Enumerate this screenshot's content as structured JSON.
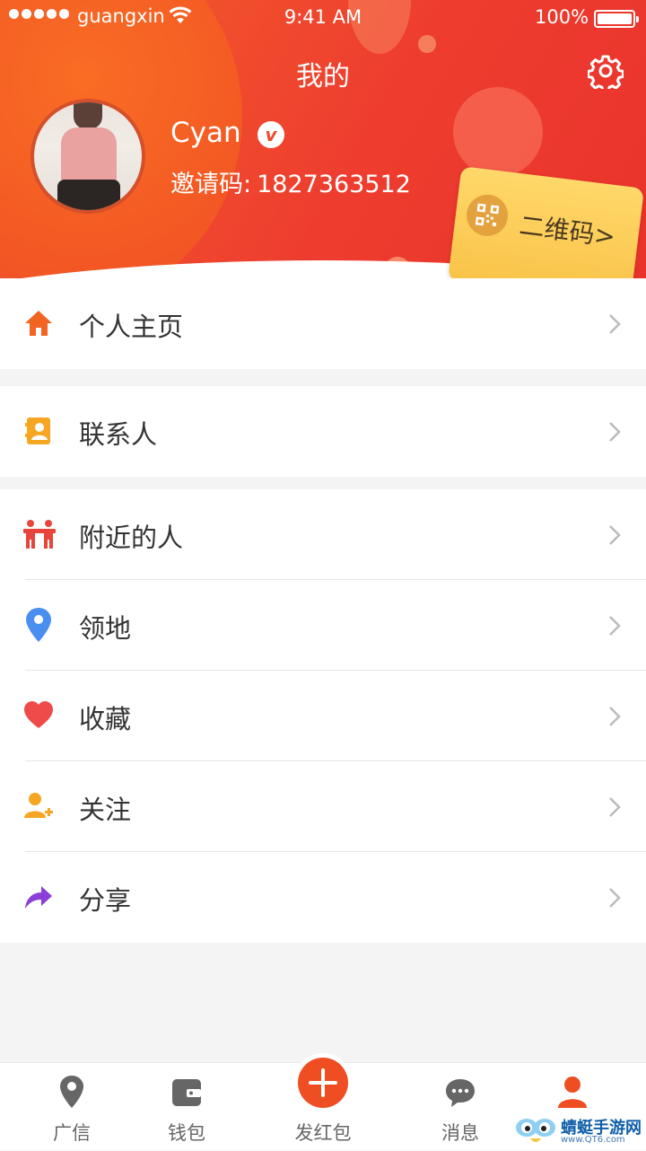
{
  "status_bar": {
    "carrier": "guangxin",
    "time": "9:41 AM",
    "battery": "100%"
  },
  "header": {
    "title": "我的"
  },
  "profile": {
    "name": "Cyan",
    "badge": "v",
    "invite_label": "邀请码:",
    "invite_code": "1827363512"
  },
  "qr_card": {
    "label": "二维码>"
  },
  "menu_groups": [
    [
      {
        "label": "个人主页",
        "icon": "home-icon",
        "color": "#f26422"
      }
    ],
    [
      {
        "label": "联系人",
        "icon": "contact-card-icon",
        "color": "#f5a623"
      }
    ],
    [
      {
        "label": "附近的人",
        "icon": "people-icon",
        "color": "#e8453c"
      },
      {
        "label": "领地",
        "icon": "location-pin-icon",
        "color": "#4a8ff0"
      },
      {
        "label": "收藏",
        "icon": "heart-icon",
        "color": "#ef4b4b"
      },
      {
        "label": "关注",
        "icon": "add-user-icon",
        "color": "#f5a623"
      },
      {
        "label": "分享",
        "icon": "share-arrow-icon",
        "color": "#8b3fd6"
      }
    ]
  ],
  "tab_bar": [
    {
      "label": "广信",
      "icon": "location-pin-icon",
      "active": false
    },
    {
      "label": "钱包",
      "icon": "wallet-icon",
      "active": false
    },
    {
      "label": "发红包",
      "icon": "plus-icon",
      "active": false
    },
    {
      "label": "消息",
      "icon": "chat-bubble-icon",
      "active": false
    },
    {
      "label": "",
      "icon": "person-icon",
      "active": true
    }
  ],
  "colors": {
    "accent": "#ef4e22",
    "inactive_icon": "#666666"
  },
  "watermark": {
    "title": "蜻蜓手游网",
    "subtitle": "www.QT6.com"
  }
}
